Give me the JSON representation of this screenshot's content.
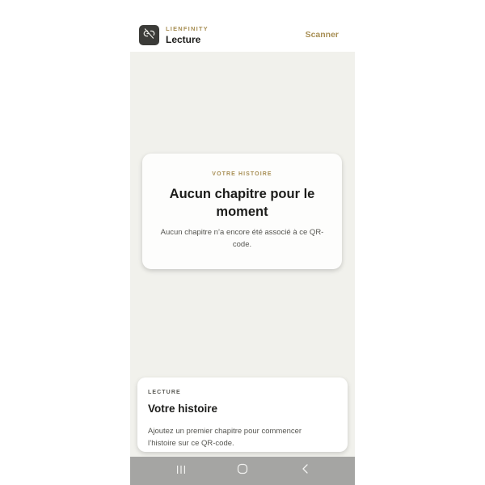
{
  "header": {
    "brand": "LIENFINITY",
    "title": "Lecture",
    "scan_label": "Scanner",
    "logo_icon": "broken-link-icon"
  },
  "empty_state": {
    "eyebrow": "VOTRE HISTOIRE",
    "title": "Aucun chapitre pour le moment",
    "text": "Aucun chapitre n’a encore été associé à ce QR-code."
  },
  "sheet": {
    "eyebrow": "LECTURE",
    "title": "Votre histoire",
    "text": "Ajoutez un premier chapitre pour commencer l’histoire sur ce QR-code."
  },
  "navbar": {
    "icons": [
      "recent-apps-icon",
      "home-icon",
      "back-icon"
    ]
  },
  "colors": {
    "accent": "#a88f55",
    "background": "#f1f1ec",
    "logo_bg": "#3b3b38",
    "navbar_bg": "#a5a5a3"
  }
}
